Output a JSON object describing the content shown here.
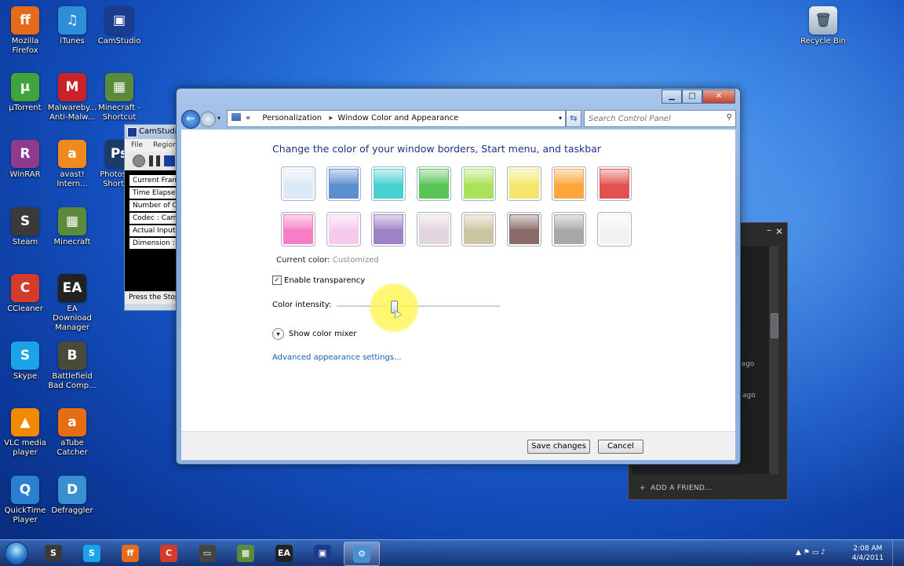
{
  "desktop": {
    "icons": [
      {
        "label": "Mozilla Firefox",
        "short": "ff",
        "color": "#e66a1b"
      },
      {
        "label": "iTunes",
        "short": "♫",
        "color": "#2e8fd8"
      },
      {
        "label": "CamStudio",
        "short": "▣",
        "color": "#1b3b8f"
      },
      {
        "label": "µTorrent",
        "short": "µ",
        "color": "#3fa43b"
      },
      {
        "label": "Malwareby... Anti-Malw...",
        "short": "M",
        "color": "#c8222a"
      },
      {
        "label": "Minecraft - Shortcut",
        "short": "▦",
        "color": "#5a8a3a"
      },
      {
        "label": "WinRAR",
        "short": "R",
        "color": "#8e3a8e"
      },
      {
        "label": "avast! Intern...",
        "short": "a",
        "color": "#f08a1e"
      },
      {
        "label": "Photosh... Shortc...",
        "short": "Ps",
        "color": "#1d3b66"
      },
      {
        "label": "Steam",
        "short": "S",
        "color": "#3a3a3a"
      },
      {
        "label": "Minecraft",
        "short": "▦",
        "color": "#5a8a3a"
      },
      {
        "label": "CCleaner",
        "short": "C",
        "color": "#d43b2a"
      },
      {
        "label": "EA Download Manager",
        "short": "EA",
        "color": "#222222"
      },
      {
        "label": "Skype",
        "short": "S",
        "color": "#1ba3e8"
      },
      {
        "label": "Battlefield Bad Comp...",
        "short": "B",
        "color": "#4a4a3a"
      },
      {
        "label": "VLC media player",
        "short": "▲",
        "color": "#f08a00"
      },
      {
        "label": "aTube Catcher",
        "short": "a",
        "color": "#e56d12"
      },
      {
        "label": "QuickTime Player",
        "short": "Q",
        "color": "#2b7fd1"
      },
      {
        "label": "Defraggler",
        "short": "D",
        "color": "#3b8fd1"
      }
    ],
    "recycle_bin": "Recycle Bin"
  },
  "camstudio": {
    "title": "CamStudio",
    "menu": [
      "File",
      "Region"
    ],
    "stats": [
      "Current Frame",
      "Time Elapsed",
      "Number of Co",
      "Codec  : Cam",
      "Actual Input F",
      "Dimension  : "
    ],
    "status": "Press the Stop"
  },
  "steam_chat": {
    "ago1": "s ago",
    "ago2": "ago",
    "add_friend": "ADD A FRIEND..."
  },
  "window": {
    "breadcrumb": [
      "Personalization",
      "Window Color and Appearance"
    ],
    "search_placeholder": "Search Control Panel",
    "heading": "Change the color of your window borders, Start menu, and taskbar",
    "swatch_colors": [
      "#dce9f7",
      "#5d8fd0",
      "#49d0d0",
      "#58c456",
      "#a9e25a",
      "#f4e66a",
      "#fca63c",
      "#e35151",
      "#f77ec4",
      "#f7c9ec",
      "#9d82c6",
      "#e2d5de",
      "#cbc5a3",
      "#8a6b68",
      "#a8a8a8",
      "#f2f2f2"
    ],
    "current_color_label": "Current color:",
    "current_color_value": "Customized",
    "transparency_label": "Enable transparency",
    "transparency_checked": true,
    "intensity_label": "Color intensity:",
    "intensity_value": 0.35,
    "mixer_label": "Show color mixer",
    "advanced_link": "Advanced appearance settings...",
    "save_label": "Save changes",
    "cancel_label": "Cancel"
  },
  "taskbar": {
    "apps": [
      {
        "name": "steam",
        "short": "S",
        "color": "#3a3a3a",
        "active": false
      },
      {
        "name": "skype",
        "short": "S",
        "color": "#1ba3e8",
        "active": false
      },
      {
        "name": "firefox",
        "short": "ff",
        "color": "#e66a1b",
        "active": false
      },
      {
        "name": "ccleaner",
        "short": "C",
        "color": "#d43b2a",
        "active": false
      },
      {
        "name": "terminal",
        "short": "▭",
        "color": "#444444",
        "active": false
      },
      {
        "name": "minecraft",
        "short": "▦",
        "color": "#5a8a3a",
        "active": false
      },
      {
        "name": "ea",
        "short": "EA",
        "color": "#222222",
        "active": false
      },
      {
        "name": "camstudio",
        "short": "▣",
        "color": "#1b3b8f",
        "active": false
      },
      {
        "name": "control-panel",
        "short": "⚙",
        "color": "#4a8fd1",
        "active": true
      }
    ],
    "time": "2:08 AM",
    "date": "4/4/2011"
  }
}
